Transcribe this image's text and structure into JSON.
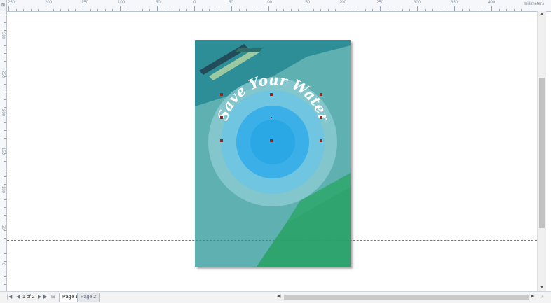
{
  "ruler": {
    "units": "millimeters",
    "corner": "⊠",
    "top_numbers": [
      "250",
      "200",
      "150",
      "100",
      "50",
      "0",
      "50",
      "100",
      "150",
      "200",
      "250",
      "300",
      "350",
      "400"
    ],
    "left_numbers": [
      "300",
      "250",
      "200",
      "150",
      "100",
      "50",
      "0"
    ]
  },
  "poster": {
    "title": "Save Your Water",
    "colors": {
      "teal_dark": "#2e8e98",
      "teal_mid": "#5fb0b0",
      "green": "#2fa46e",
      "circle_outer": "#8fcdd6",
      "circle_mid": "#5fbfe5",
      "circle_inner": "#3aafe8",
      "circle_core": "#2aa8e6",
      "stripe_dark": "#234c5a",
      "stripe_light": "#9cc9a0",
      "selection_handle": "#8b2a2a"
    }
  },
  "navigation": {
    "first": "|◀",
    "prev": "◀",
    "page_of": "1 of 2",
    "next": "▶",
    "last": "▶|",
    "add_page": "⊞",
    "tabs": [
      "Page 1",
      "Page 2"
    ]
  },
  "scroll": {
    "up": "▲",
    "down": "▼",
    "left": "◀",
    "right": "▶",
    "zoom": "⌕"
  }
}
